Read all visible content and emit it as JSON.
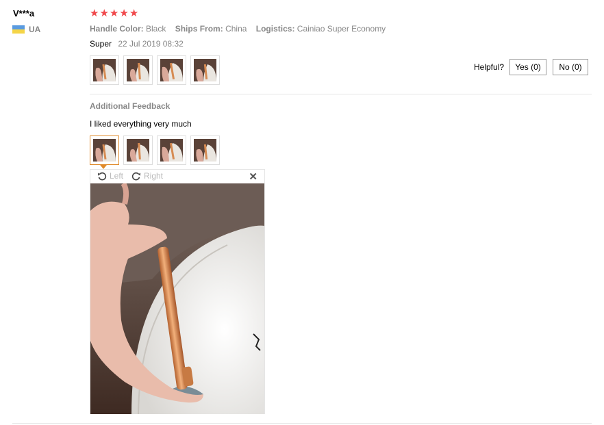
{
  "user": {
    "name": "V***a",
    "country": "UA",
    "flag_icon": "ukraine-flag-icon"
  },
  "rating": {
    "stars": 5,
    "max": 5,
    "color": "#f0494c"
  },
  "attributes": [
    {
      "key": "Handle Color:",
      "value": "Black"
    },
    {
      "key": "Ships From:",
      "value": "China"
    },
    {
      "key": "Logistics:",
      "value": "Cainiao Super Economy"
    }
  ],
  "review": {
    "text": "Super",
    "date": "22 Jul 2019 08:32"
  },
  "helpful": {
    "label": "Helpful?",
    "yes": "Yes (0)",
    "no": "No (0)"
  },
  "additional": {
    "title": "Additional Feedback",
    "text": "I liked everything very much"
  },
  "viewer": {
    "rotate_left": "Left",
    "rotate_right": "Right",
    "close_icon": "close-icon"
  },
  "colors": {
    "accent": "#e08a2a"
  }
}
